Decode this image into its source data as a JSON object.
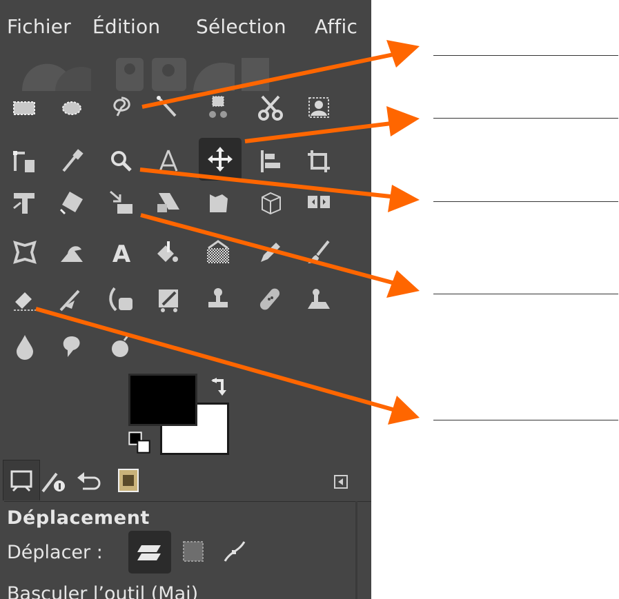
{
  "menubar": {
    "items": [
      {
        "label": "Fichier"
      },
      {
        "label": "Édition"
      },
      {
        "label": "Sélection"
      },
      {
        "label": "Affic"
      }
    ]
  },
  "toolbox": {
    "rows": [
      [
        "rect-select-icon",
        "ellipse-select-icon",
        "free-select-icon",
        "fuzzy-select-icon",
        "select-by-color-icon",
        "scissors-select-icon",
        "foreground-select-icon"
      ],
      [
        "paths-icon",
        "color-picker-icon",
        "zoom-icon",
        "measure-icon",
        "move-icon",
        "align-icon",
        "crop-icon"
      ],
      [
        "unified-transform-icon",
        "rotate-icon",
        "scale-icon",
        "shear-icon",
        "perspective-icon",
        "3d-transform-icon",
        "flip-icon"
      ],
      [
        "cage-transform-icon",
        "warp-transform-icon",
        "text-icon",
        "bucket-fill-icon",
        "gradient-icon",
        "pencil-icon",
        "paintbrush-icon"
      ],
      [
        "eraser-icon",
        "airbrush-icon",
        "ink-icon",
        "mypaint-brush-icon",
        "clone-icon",
        "heal-icon",
        "perspective-clone-icon"
      ],
      [
        "blur-icon",
        "smudge-icon",
        "dodge-burn-icon"
      ]
    ],
    "active_tool": "move-icon"
  },
  "colors": {
    "foreground": "#000000",
    "background": "#ffffff"
  },
  "tool_options": {
    "title": "Déplacement",
    "move_label": "Déplacer :",
    "toggle_label": "Basculer l’outil  (Maj)"
  },
  "accent": "#ff6600"
}
